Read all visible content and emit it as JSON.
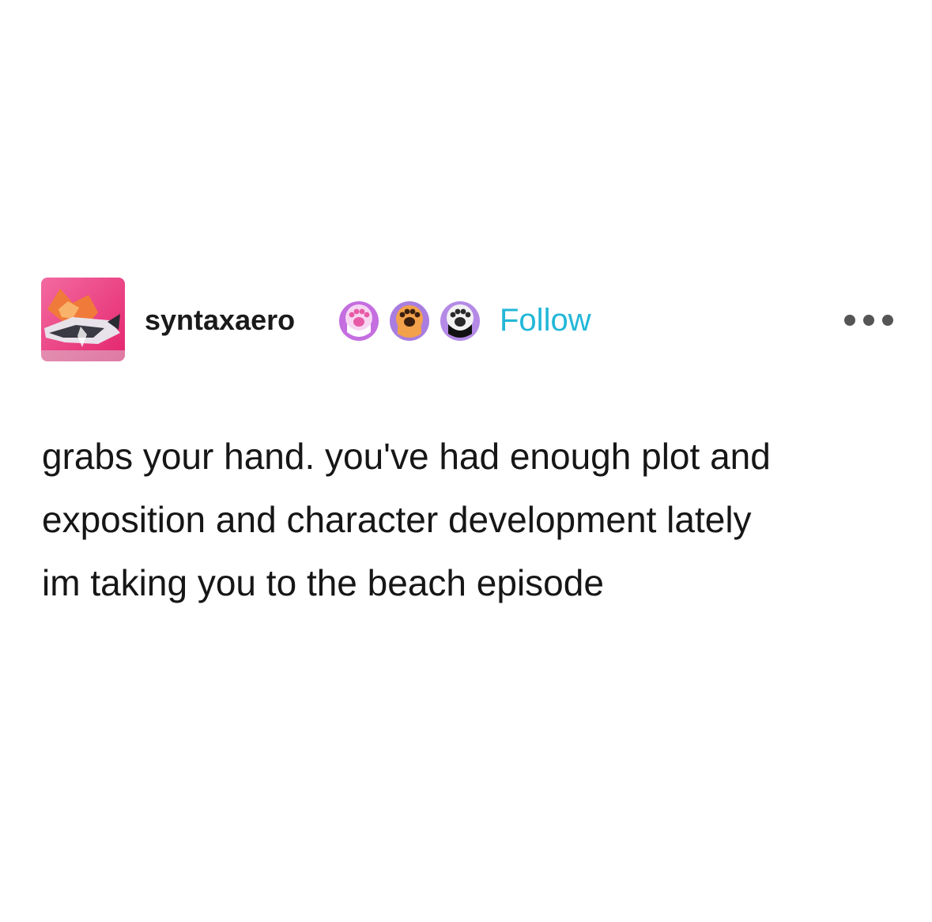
{
  "post": {
    "username": "syntaxaero",
    "follow_label": "Follow",
    "badges": [
      {
        "icon": "paw-badge-pink-icon",
        "color": "#d67ad8"
      },
      {
        "icon": "paw-badge-orange-icon",
        "color": "#f0a050"
      },
      {
        "icon": "paw-badge-black-icon",
        "color": "#222222"
      }
    ],
    "more_icon": "ellipsis-icon",
    "lines": [
      "grabs your hand. you've had enough plot and",
      "exposition and character development lately",
      "im taking you to the beach episode"
    ]
  },
  "colors": {
    "follow": "#22b7d8",
    "text": "#161616",
    "avatar_bg": "#ef3d87"
  }
}
